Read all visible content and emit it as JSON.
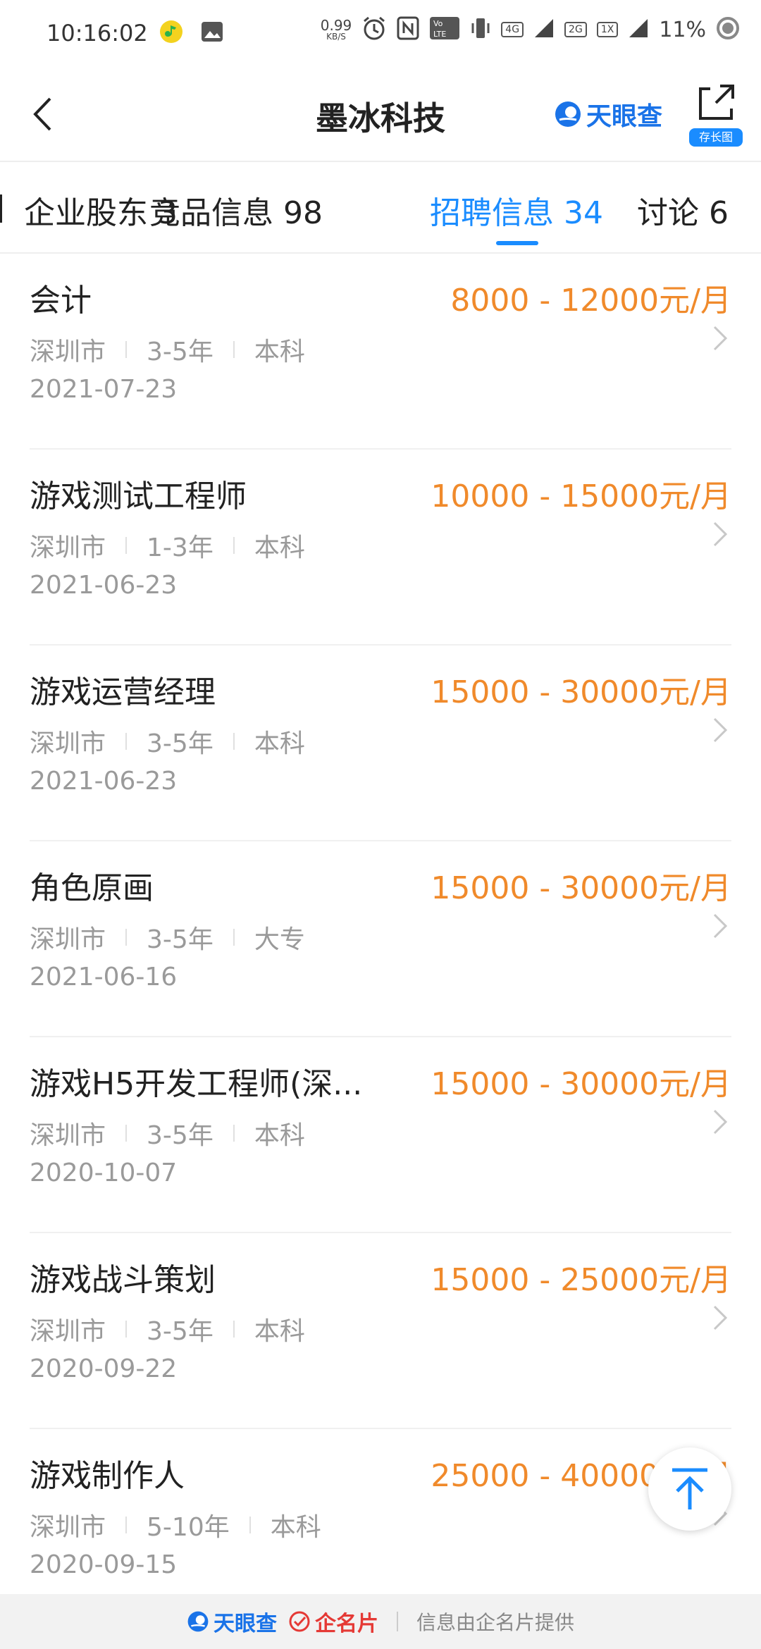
{
  "status_bar": {
    "time": "10:16:02",
    "net_speed_value": "0.99",
    "net_speed_unit": "KB/S",
    "network_4g": "4G",
    "network_2g": "2G",
    "network_1x": "1X",
    "battery": "11%"
  },
  "header": {
    "title": "墨冰科技",
    "brand": "天眼查",
    "export_label": "存长图"
  },
  "tabs": [
    {
      "label": "企业股东 3"
    },
    {
      "label": "竞品信息 98"
    },
    {
      "label": "招聘信息 34"
    },
    {
      "label": "讨论 6"
    }
  ],
  "jobs": [
    {
      "title": "会计",
      "salary": "8000 - 12000元/月",
      "city": "深圳市",
      "experience": "3-5年",
      "education": "本科",
      "date": "2021-07-23"
    },
    {
      "title": "游戏测试工程师",
      "salary": "10000 - 15000元/月",
      "city": "深圳市",
      "experience": "1-3年",
      "education": "本科",
      "date": "2021-06-23"
    },
    {
      "title": "游戏运营经理",
      "salary": "15000 - 30000元/月",
      "city": "深圳市",
      "experience": "3-5年",
      "education": "本科",
      "date": "2021-06-23"
    },
    {
      "title": "角色原画",
      "salary": "15000 - 30000元/月",
      "city": "深圳市",
      "experience": "3-5年",
      "education": "大专",
      "date": "2021-06-16"
    },
    {
      "title": "游戏H5开发工程师(深...",
      "salary": "15000 - 30000元/月",
      "city": "深圳市",
      "experience": "3-5年",
      "education": "本科",
      "date": "2020-10-07"
    },
    {
      "title": "游戏战斗策划",
      "salary": "15000 - 25000元/月",
      "city": "深圳市",
      "experience": "3-5年",
      "education": "本科",
      "date": "2020-09-22"
    },
    {
      "title": "游戏制作人",
      "salary": "25000 - 40000元/月",
      "city": "深圳市",
      "experience": "5-10年",
      "education": "本科",
      "date": "2020-09-15"
    }
  ],
  "footer": {
    "brand": "天眼查",
    "card_brand": "企名片",
    "note": "信息由企名片提供"
  },
  "colors": {
    "accent": "#1a8cff",
    "salary": "#f08a2b",
    "meta": "#9a9a9a"
  }
}
